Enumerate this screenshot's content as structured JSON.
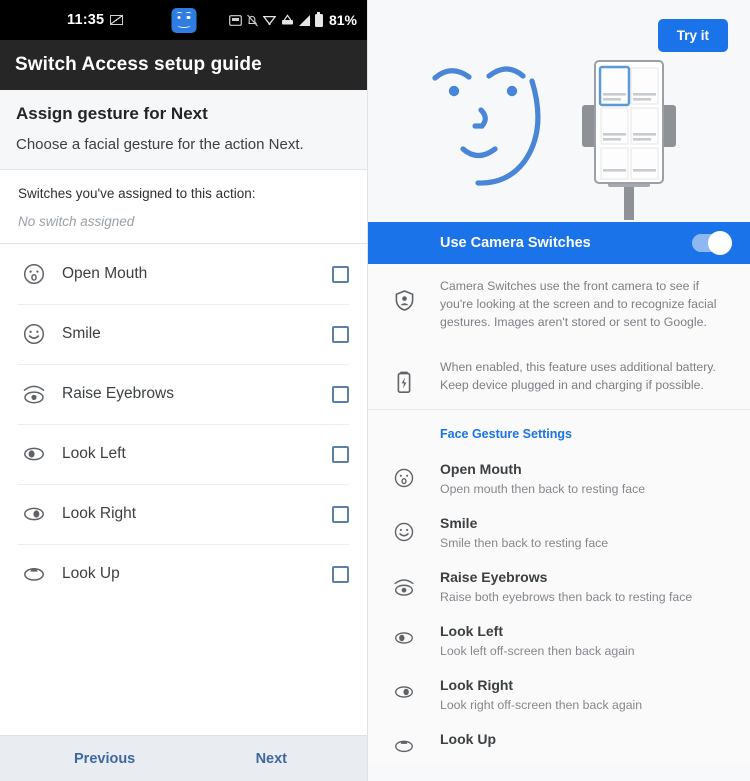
{
  "left": {
    "statusbar": {
      "time": "11:35",
      "battery_percent": "81%",
      "icons": [
        "mail-icon",
        "face-switch-icon",
        "screenshot-icon",
        "notifications-muted-icon",
        "wifi-icon",
        "vpn-icon",
        "signal-icon",
        "battery-icon"
      ]
    },
    "appbar": {
      "title": "Switch Access setup guide"
    },
    "assign": {
      "title": "Assign gesture for Next",
      "subtitle": "Choose a facial gesture for the action Next."
    },
    "assigned": {
      "label": "Switches you've assigned to this action:",
      "value": "No switch assigned"
    },
    "gestures": [
      {
        "icon": "open-mouth-icon",
        "label": "Open Mouth",
        "checked": false
      },
      {
        "icon": "smile-icon",
        "label": "Smile",
        "checked": false
      },
      {
        "icon": "raise-eyebrows-icon",
        "label": "Raise Eyebrows",
        "checked": false
      },
      {
        "icon": "look-left-icon",
        "label": "Look Left",
        "checked": false
      },
      {
        "icon": "look-right-icon",
        "label": "Look Right",
        "checked": false
      },
      {
        "icon": "look-up-icon",
        "label": "Look Up",
        "checked": false
      }
    ],
    "bottombar": {
      "previous": "Previous",
      "next": "Next"
    }
  },
  "right": {
    "hero": {
      "try_button": "Try it"
    },
    "camera_switches": {
      "label": "Use Camera Switches",
      "enabled": true
    },
    "info": [
      {
        "icon": "privacy-shield-icon",
        "text": "Camera Switches use the front camera to see if you're looking at the screen and to recognize facial gestures. Images aren't stored or sent to Google."
      },
      {
        "icon": "battery-charging-icon",
        "text": "When enabled, this feature uses additional battery. Keep device plugged in and charging if possible."
      }
    ],
    "face_gesture_settings": {
      "header": "Face Gesture Settings",
      "items": [
        {
          "icon": "open-mouth-icon",
          "title": "Open Mouth",
          "desc": "Open mouth then back to resting face"
        },
        {
          "icon": "smile-icon",
          "title": "Smile",
          "desc": "Smile then back to resting face"
        },
        {
          "icon": "raise-eyebrows-icon",
          "title": "Raise Eyebrows",
          "desc": "Raise both eyebrows then back to resting face"
        },
        {
          "icon": "look-left-icon",
          "title": "Look Left",
          "desc": "Look left off-screen then back again"
        },
        {
          "icon": "look-right-icon",
          "title": "Look Right",
          "desc": "Look right off-screen then back again"
        },
        {
          "icon": "look-up-icon",
          "title": "Look Up",
          "desc": ""
        }
      ]
    }
  },
  "colors": {
    "accent_blue": "#1a73e8",
    "statusbar_black": "#000000",
    "appbar_dark": "#262626",
    "panel_bg": "#eef1f5",
    "link_blue": "#3f68a0",
    "illustration_blue": "#4a86d8"
  }
}
